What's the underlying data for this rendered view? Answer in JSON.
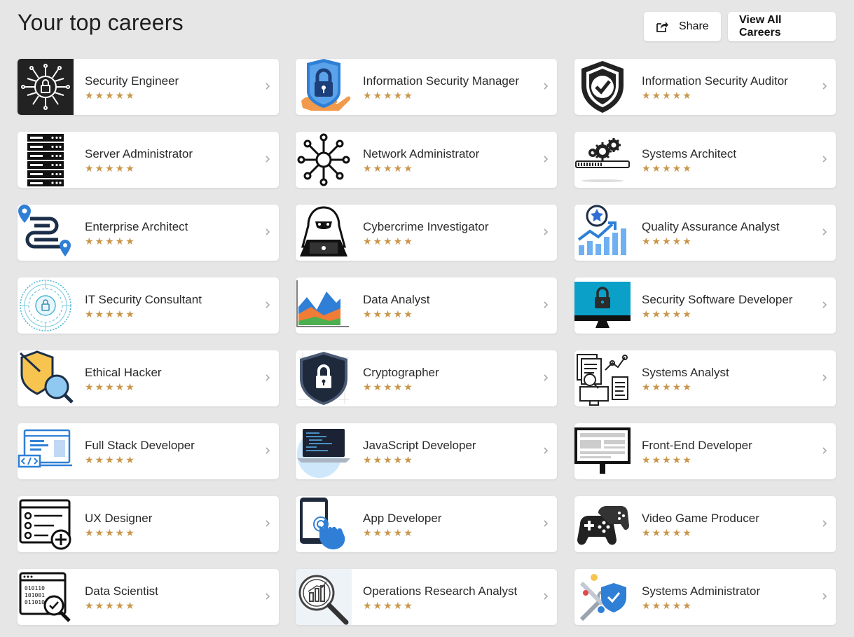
{
  "page": {
    "title": "Your top careers",
    "share_label": "Share",
    "view_all_label": "View All Careers",
    "star_color": "#c9974c",
    "background": "#e6e6e6"
  },
  "careers": [
    {
      "title": "Security Engineer",
      "icon": "security-engineer-chip-lock-icon",
      "rating": 5
    },
    {
      "title": "Information Security Manager",
      "icon": "padlock-in-hand-icon",
      "rating": 5
    },
    {
      "title": "Information Security Auditor",
      "icon": "shield-check-icon",
      "rating": 5
    },
    {
      "title": "Server Administrator",
      "icon": "server-rack-icon",
      "rating": 5
    },
    {
      "title": "Network Administrator",
      "icon": "network-hub-icon",
      "rating": 5
    },
    {
      "title": "Systems Architect",
      "icon": "gears-progress-icon",
      "rating": 5
    },
    {
      "title": "Enterprise Architect",
      "icon": "route-pins-icon",
      "rating": 5
    },
    {
      "title": "Cybercrime Investigator",
      "icon": "hooded-hacker-laptop-icon",
      "rating": 5
    },
    {
      "title": "Quality Assurance Analyst",
      "icon": "star-badge-growth-chart-icon",
      "rating": 5
    },
    {
      "title": "IT Security Consultant",
      "icon": "circular-lock-circuit-icon",
      "rating": 5
    },
    {
      "title": "Data Analyst",
      "icon": "area-chart-icon",
      "rating": 5
    },
    {
      "title": "Security Software Developer",
      "icon": "monitor-lock-icon",
      "rating": 5
    },
    {
      "title": "Ethical Hacker",
      "icon": "shield-magnifier-icon",
      "rating": 5
    },
    {
      "title": "Cryptographer",
      "icon": "dark-shield-lock-icon",
      "rating": 5
    },
    {
      "title": "Systems Analyst",
      "icon": "documents-magnifier-icon",
      "rating": 5
    },
    {
      "title": "Full Stack Developer",
      "icon": "browser-code-icon",
      "rating": 5
    },
    {
      "title": "JavaScript Developer",
      "icon": "laptop-code-icon",
      "rating": 5
    },
    {
      "title": "Front-End Developer",
      "icon": "monitor-layout-icon",
      "rating": 5
    },
    {
      "title": "UX Designer",
      "icon": "list-add-window-icon",
      "rating": 5
    },
    {
      "title": "App Developer",
      "icon": "phone-tap-hand-icon",
      "rating": 5
    },
    {
      "title": "Video Game Producer",
      "icon": "gamepads-icon",
      "rating": 5
    },
    {
      "title": "Data Scientist",
      "icon": "binary-window-magnifier-icon",
      "rating": 5
    },
    {
      "title": "Operations Research Analyst",
      "icon": "chart-magnifier-icon",
      "rating": 5
    },
    {
      "title": "Systems Administrator",
      "icon": "tools-shield-check-icon",
      "rating": 5
    }
  ]
}
